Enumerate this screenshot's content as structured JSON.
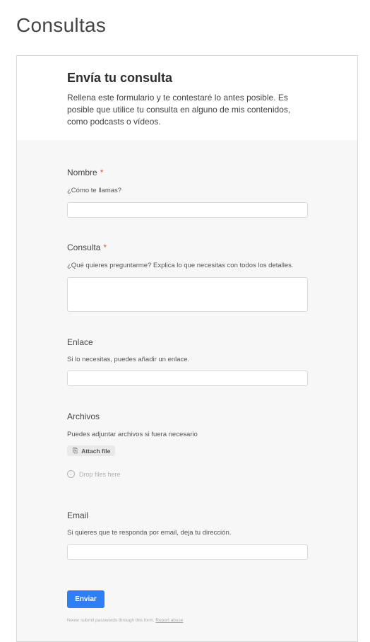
{
  "page": {
    "title": "Consultas"
  },
  "form": {
    "heading": "Envía tu consulta",
    "intro": "Rellena este formulario y te contestaré lo antes posible. Es posible que utilice tu consulta en alguno de mis contenidos, como podcasts o vídeos.",
    "fields": {
      "nombre": {
        "label": "Nombre",
        "required_mark": "*",
        "hint": "¿Cómo te llamas?",
        "value": ""
      },
      "consulta": {
        "label": "Consulta",
        "required_mark": "*",
        "hint": "¿Qué quieres preguntarme? Explica lo que necesitas con todos los detalles.",
        "value": ""
      },
      "enlace": {
        "label": "Enlace",
        "hint": "Si lo necesitas, puedes añadir un enlace.",
        "value": ""
      },
      "archivos": {
        "label": "Archivos",
        "hint": "Puedes adjuntar archivos si fuera necesario",
        "attach_label": "Attach file",
        "drop_label": "Drop files here"
      },
      "email": {
        "label": "Email",
        "hint": "Si quieres que te responda por email, deja tu dirección.",
        "value": ""
      }
    },
    "submit_label": "Enviar",
    "footer": {
      "note": "Never submit passwords through this form.",
      "report_link": "Report abuse"
    }
  },
  "colors": {
    "accent": "#2e7ff5",
    "required": "#d9534f",
    "panel": "#f7f7f7"
  },
  "icons": {
    "attach": "paperclip-icon",
    "drop": "download-arrow-icon"
  }
}
